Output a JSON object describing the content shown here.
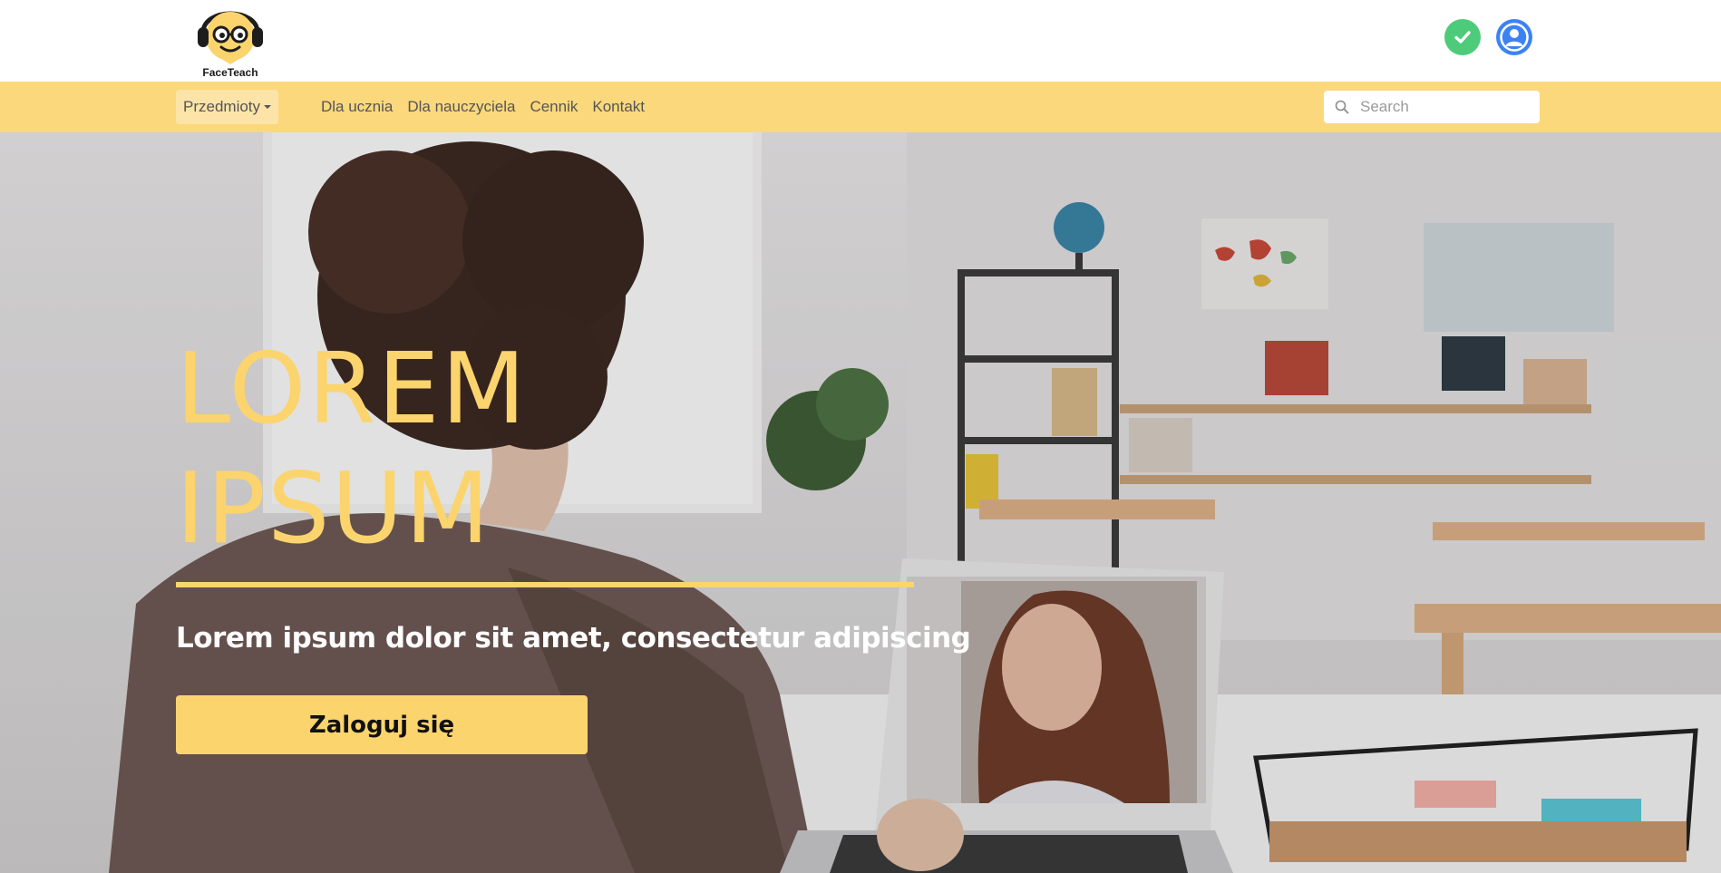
{
  "header": {
    "logo_text": "FaceTeach",
    "status_check_icon": "check-icon",
    "user_icon": "user-icon",
    "colors": {
      "check": "#4ecb7a",
      "user": "#3b82f6"
    }
  },
  "nav": {
    "dropdown_label": "Przedmioty",
    "links": [
      {
        "label": "Dla ucznia"
      },
      {
        "label": "Dla nauczyciela"
      },
      {
        "label": "Cennik"
      },
      {
        "label": "Kontakt"
      }
    ],
    "search": {
      "placeholder": "Search",
      "value": ""
    },
    "background": "#fbd87c"
  },
  "hero": {
    "title_line1": "LOREM",
    "title_line2": "IPSUM",
    "subtitle": "Lorem ipsum dolor sit amet, consectetur adipiscing",
    "login_button": "Zaloguj się",
    "accent": "#fbd46e"
  }
}
